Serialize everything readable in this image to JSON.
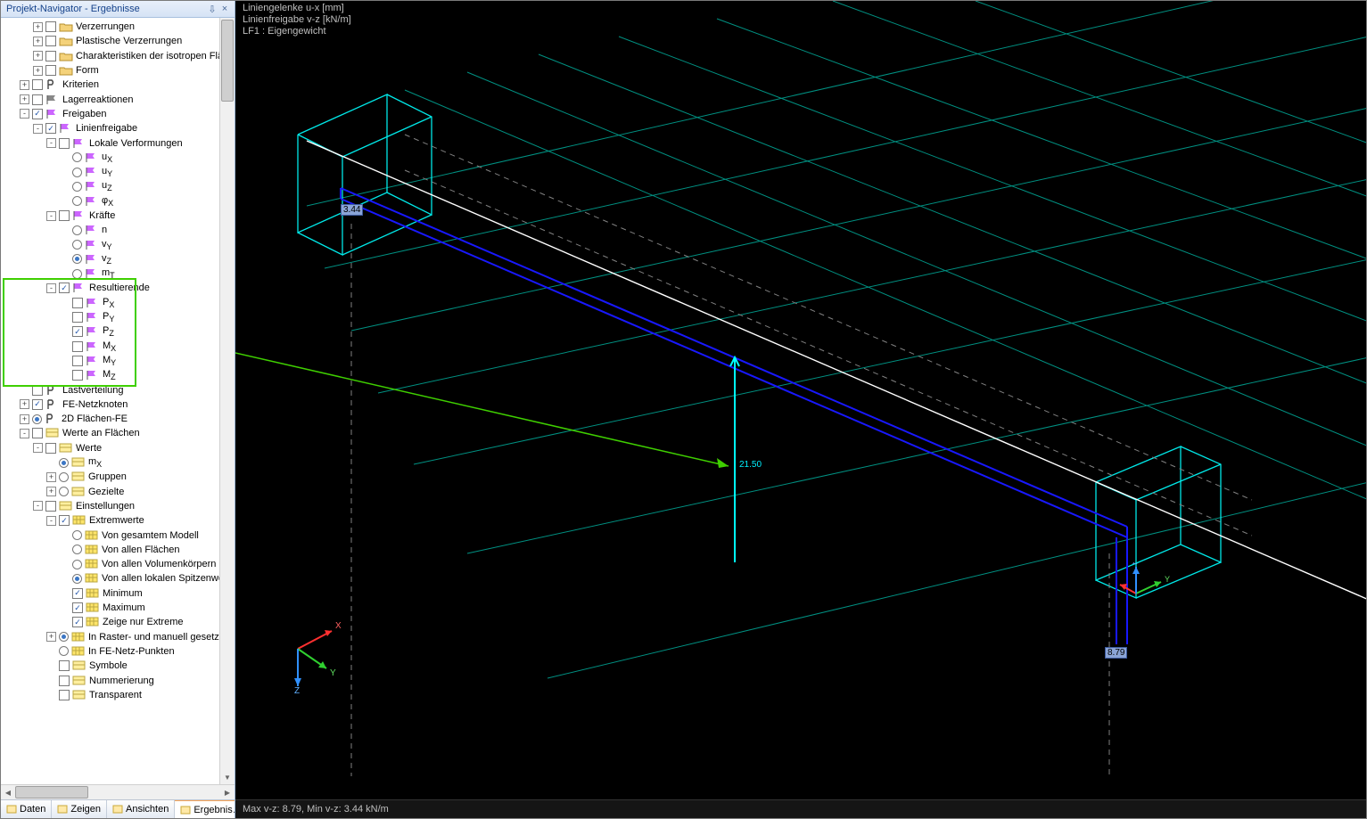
{
  "sidebar": {
    "title": "Projekt-Navigator - Ergebnisse",
    "tree": [
      {
        "indent": 2,
        "exp": "+",
        "chk": "unchecked",
        "icon": "folder",
        "label": "Verzerrungen"
      },
      {
        "indent": 2,
        "exp": "+",
        "chk": "unchecked",
        "icon": "folder",
        "label": "Plastische Verzerrungen"
      },
      {
        "indent": 2,
        "exp": "+",
        "chk": "unchecked",
        "icon": "folder",
        "label": "Charakteristiken der isotropen Fläc"
      },
      {
        "indent": 2,
        "exp": "+",
        "chk": "unchecked",
        "icon": "folder",
        "label": "Form"
      },
      {
        "indent": 1,
        "exp": "+",
        "chk": "unchecked",
        "icon": "bracket",
        "label": "Kriterien"
      },
      {
        "indent": 1,
        "exp": "+",
        "chk": "unchecked",
        "icon": "flag-meta",
        "label": "Lagerreaktionen"
      },
      {
        "indent": 1,
        "exp": "-",
        "chk": "checked",
        "icon": "flag",
        "label": "Freigaben"
      },
      {
        "indent": 2,
        "exp": "-",
        "chk": "checked",
        "icon": "flag",
        "label": "Linienfreigabe"
      },
      {
        "indent": 3,
        "exp": "-",
        "chk": "unchecked",
        "icon": "flag",
        "label": "Lokale Verformungen"
      },
      {
        "indent": 4,
        "exp": "",
        "rad": "unchecked",
        "icon": "flag",
        "label": "uX",
        "sub": true
      },
      {
        "indent": 4,
        "exp": "",
        "rad": "unchecked",
        "icon": "flag",
        "label": "uY",
        "sub": true
      },
      {
        "indent": 4,
        "exp": "",
        "rad": "unchecked",
        "icon": "flag",
        "label": "uZ",
        "sub": true
      },
      {
        "indent": 4,
        "exp": "",
        "rad": "unchecked",
        "icon": "flag",
        "label": "φX",
        "sub": true
      },
      {
        "indent": 3,
        "exp": "-",
        "chk": "unchecked",
        "icon": "flag",
        "label": "Kräfte"
      },
      {
        "indent": 4,
        "exp": "",
        "rad": "unchecked",
        "icon": "flag",
        "label": "n"
      },
      {
        "indent": 4,
        "exp": "",
        "rad": "unchecked",
        "icon": "flag",
        "label": "vY",
        "sub": true
      },
      {
        "indent": 4,
        "exp": "",
        "rad": "checked",
        "icon": "flag",
        "label": "vZ",
        "sub": true
      },
      {
        "indent": 4,
        "exp": "",
        "rad": "unchecked",
        "icon": "flag",
        "label": "mT",
        "sub": true
      },
      {
        "indent": 3,
        "exp": "-",
        "chk": "checked",
        "icon": "flag",
        "label": "Resultierende",
        "hlstart": true
      },
      {
        "indent": 4,
        "exp": "",
        "chk": "unchecked",
        "icon": "flag",
        "label": "PX",
        "sub": true
      },
      {
        "indent": 4,
        "exp": "",
        "chk": "unchecked",
        "icon": "flag",
        "label": "PY",
        "sub": true
      },
      {
        "indent": 4,
        "exp": "",
        "chk": "checked",
        "icon": "flag",
        "label": "PZ",
        "sub": true
      },
      {
        "indent": 4,
        "exp": "",
        "chk": "unchecked",
        "icon": "flag",
        "label": "MX",
        "sub": true
      },
      {
        "indent": 4,
        "exp": "",
        "chk": "unchecked",
        "icon": "flag",
        "label": "MY",
        "sub": true
      },
      {
        "indent": 4,
        "exp": "",
        "chk": "unchecked",
        "icon": "flag",
        "label": "MZ",
        "sub": true,
        "hlend": true
      },
      {
        "indent": 1,
        "exp": "",
        "chk": "unchecked",
        "icon": "bracket",
        "label": "Lastverteilung"
      },
      {
        "indent": 1,
        "exp": "+",
        "chk": "checked",
        "icon": "bracket",
        "label": "FE-Netzknoten"
      },
      {
        "indent": 1,
        "exp": "+",
        "rad": "checked",
        "icon": "bracket",
        "label": "2D Flächen-FE"
      },
      {
        "indent": 1,
        "exp": "-",
        "chk": "unchecked",
        "icon": "tile",
        "label": "Werte an Flächen"
      },
      {
        "indent": 2,
        "exp": "-",
        "chk": "unchecked",
        "icon": "tile",
        "label": "Werte"
      },
      {
        "indent": 3,
        "exp": "",
        "rad": "checked",
        "icon": "tile",
        "label": "mX",
        "sub": true
      },
      {
        "indent": 3,
        "exp": "+",
        "rad": "unchecked",
        "icon": "tile",
        "label": "Gruppen"
      },
      {
        "indent": 3,
        "exp": "+",
        "rad": "unchecked",
        "icon": "tile",
        "label": "Gezielte"
      },
      {
        "indent": 2,
        "exp": "-",
        "chk": "unchecked",
        "icon": "tile",
        "label": "Einstellungen"
      },
      {
        "indent": 3,
        "exp": "-",
        "chk": "checked",
        "icon": "grid",
        "label": "Extremwerte"
      },
      {
        "indent": 4,
        "exp": "",
        "rad": "unchecked",
        "icon": "grid",
        "label": "Von gesamtem Modell"
      },
      {
        "indent": 4,
        "exp": "",
        "rad": "unchecked",
        "icon": "grid",
        "label": "Von allen Flächen"
      },
      {
        "indent": 4,
        "exp": "",
        "rad": "unchecked",
        "icon": "grid",
        "label": "Von allen Volumenkörpern"
      },
      {
        "indent": 4,
        "exp": "",
        "rad": "checked",
        "icon": "grid",
        "label": "Von allen lokalen Spitzenwe"
      },
      {
        "indent": 4,
        "exp": "",
        "chk": "checked",
        "icon": "grid",
        "label": "Minimum"
      },
      {
        "indent": 4,
        "exp": "",
        "chk": "checked",
        "icon": "grid",
        "label": "Maximum"
      },
      {
        "indent": 4,
        "exp": "",
        "chk": "checked",
        "icon": "grid",
        "label": "Zeige nur Extreme"
      },
      {
        "indent": 3,
        "exp": "+",
        "rad": "checked",
        "icon": "grid",
        "label": "In Raster- und manuell gesetzte"
      },
      {
        "indent": 3,
        "exp": "",
        "rad": "unchecked",
        "icon": "grid",
        "label": "In FE-Netz-Punkten"
      },
      {
        "indent": 3,
        "exp": "",
        "chk": "unchecked",
        "icon": "tile",
        "label": "Symbole"
      },
      {
        "indent": 3,
        "exp": "",
        "chk": "unchecked",
        "icon": "tile",
        "label": "Nummerierung"
      },
      {
        "indent": 3,
        "exp": "",
        "chk": "unchecked",
        "icon": "tile",
        "label": "Transparent"
      }
    ],
    "highlight_label_range": {
      "start": "Resultierende",
      "end": "MZ"
    },
    "tabs": [
      {
        "id": "daten",
        "label": "Daten"
      },
      {
        "id": "zeigen",
        "label": "Zeigen"
      },
      {
        "id": "ansichten",
        "label": "Ansichten"
      },
      {
        "id": "ergebnisse",
        "label": "Ergebnis…",
        "active": true
      }
    ]
  },
  "viewport": {
    "header_lines": [
      "Liniengelenke u-x [mm]",
      "Linienfreigabe v-z [kN/m]",
      "LF1 : Eigengewicht"
    ],
    "annotations": {
      "value_center": "21.50",
      "box_left": "3.44",
      "box_right": "8.79"
    },
    "axis_viewport": {
      "x": "X",
      "y": "Y",
      "z": "Z"
    },
    "axis_local": {
      "x": "X",
      "y": "Y",
      "z": "Z"
    },
    "status": "Max v-z: 8.79, Min v-z: 3.44 kN/m",
    "colors": {
      "grid": "#00b0a0",
      "section": "#00e5e5",
      "beam": "#1a1aff",
      "construction": "#808080"
    }
  }
}
